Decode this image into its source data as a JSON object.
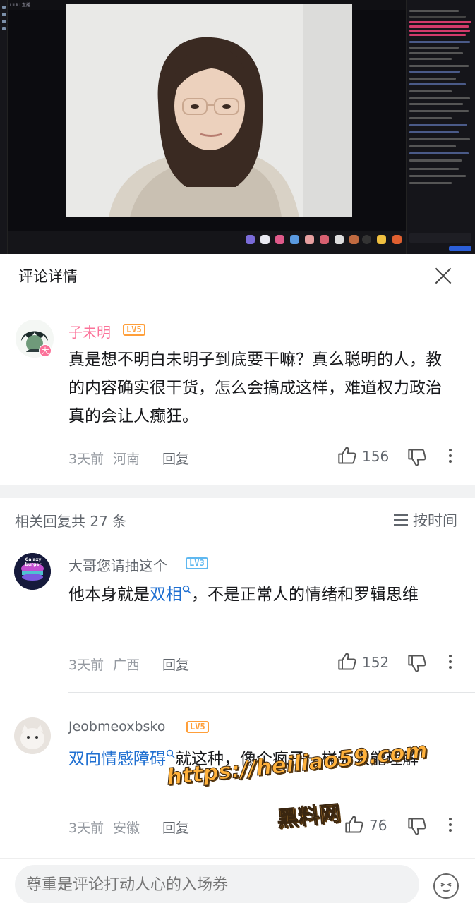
{
  "stream": {
    "brand": "LiLiLi 直播"
  },
  "panel": {
    "title": "评论详情"
  },
  "main_comment": {
    "username": "子未明",
    "level": "LV5",
    "avatar_badge": "大",
    "text": "真是想不明白未明子到底要干嘛？真么聪明的人，教的内容确实很干货，怎么会搞成这样，难道权力政治真的会让人癫狂。",
    "time": "3天前",
    "location": "河南",
    "reply_label": "回复",
    "likes": "156"
  },
  "replies_header": {
    "count_text": "相关回复共 27 条",
    "sort_label": "按时间"
  },
  "replies": [
    {
      "username": "大哥您请抽这个",
      "level": "LV3",
      "avatar_text": "Galaxy burger",
      "text_before": "他本身就是",
      "link": "双相",
      "text_after": "，不是正常人的情绪和罗辑思维",
      "time": "3天前",
      "location": "广西",
      "reply_label": "回复",
      "likes": "152"
    },
    {
      "username": "Jeobmeoxbsko",
      "level": "LV5",
      "link": "双向情感障碍",
      "text_after": "就这种，像个疯子一样无人能理解",
      "time": "3天前",
      "location": "安徽",
      "reply_label": "回复",
      "likes": "76"
    }
  ],
  "watermark": {
    "url": "https://heiliao59.com",
    "name": "黑料网"
  },
  "composer": {
    "placeholder": "尊重是评论打动人心的入场券"
  },
  "colors": {
    "accent_pink": "#fb7299",
    "link_blue": "#1f6fd1",
    "lv5": "#ff9f3a",
    "lv3": "#5fb8f0"
  }
}
